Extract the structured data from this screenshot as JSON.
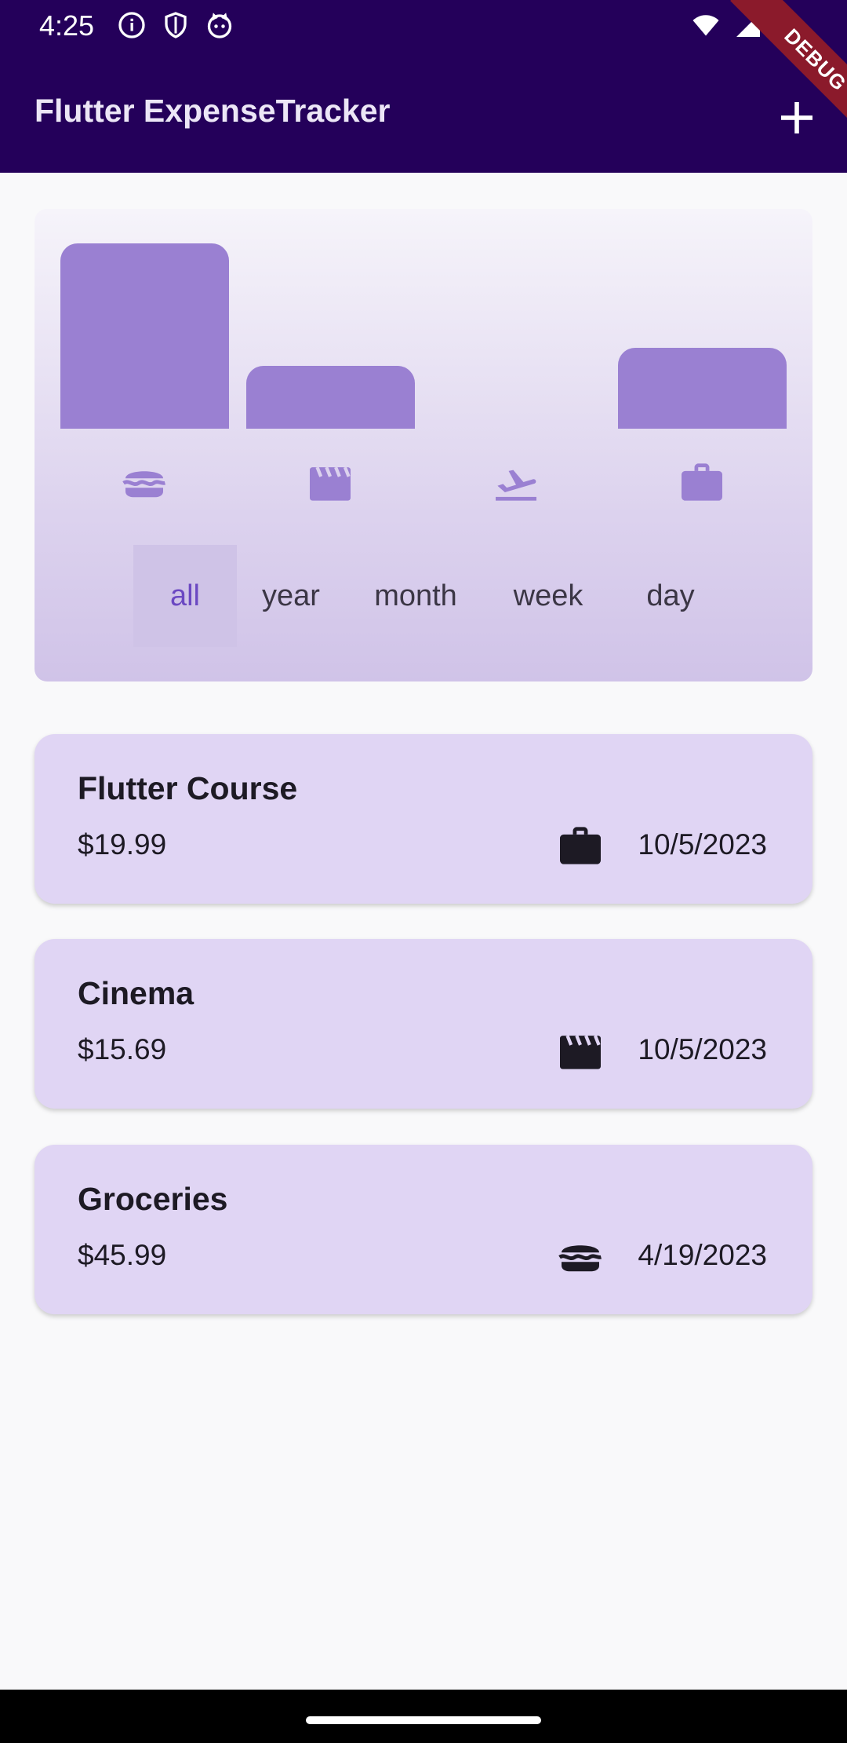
{
  "status_bar": {
    "time": "4:25",
    "left_icons": [
      "info-icon",
      "shield-icon",
      "cat-icon"
    ],
    "right_icons": [
      "wifi-icon",
      "signal-icon",
      "battery-icon"
    ]
  },
  "app_bar": {
    "title": "Flutter ExpenseTracker",
    "add_icon": "plus-icon",
    "debug_label": "DEBUG",
    "background": "#24005a"
  },
  "chart": {
    "bar_color": "#9a80d2",
    "categories": [
      {
        "name": "food",
        "icon": "burger-icon",
        "level": 1.0
      },
      {
        "name": "leisure",
        "icon": "movie-clapper-icon",
        "level": 0.34
      },
      {
        "name": "travel",
        "icon": "flight-takeoff-icon",
        "level": 0.0
      },
      {
        "name": "work",
        "icon": "briefcase-icon",
        "level": 0.435
      }
    ]
  },
  "filters": {
    "selected": "all",
    "options": [
      "all",
      "year",
      "month",
      "week",
      "day"
    ]
  },
  "expenses": [
    {
      "title": "Flutter Course",
      "amount": "$19.99",
      "icon": "briefcase-icon",
      "date": "10/5/2023"
    },
    {
      "title": "Cinema",
      "amount": "$15.69",
      "icon": "movie-clapper-icon",
      "date": "10/5/2023"
    },
    {
      "title": "Groceries",
      "amount": "$45.99",
      "icon": "burger-icon",
      "date": "4/19/2023"
    }
  ]
}
